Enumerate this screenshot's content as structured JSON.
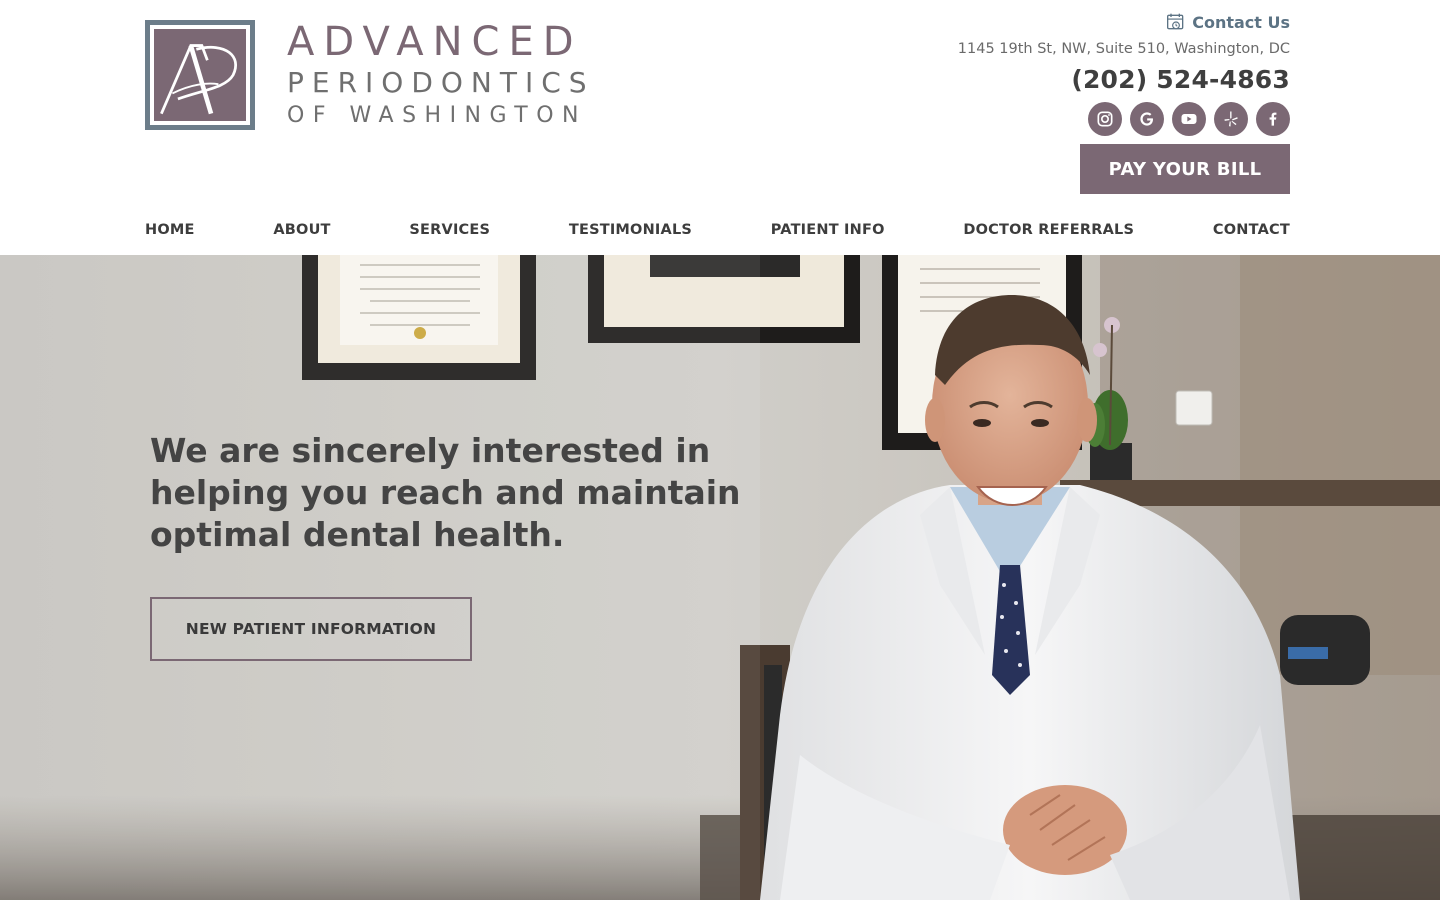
{
  "brand": {
    "line1": "ADVANCED",
    "line2": "PERIODONTICS",
    "line3": "OF WASHINGTON",
    "color_primary": "#7b6874",
    "color_frame": "#6c7d8a"
  },
  "contact": {
    "link_label": "Contact Us",
    "address": "1145 19th St, NW, Suite 510, Washington, DC",
    "phone": "(202) 524-4863"
  },
  "socials": [
    {
      "name": "instagram-icon"
    },
    {
      "name": "google-icon"
    },
    {
      "name": "youtube-icon"
    },
    {
      "name": "yelp-icon"
    },
    {
      "name": "facebook-icon"
    }
  ],
  "pay_bill_label": "PAY YOUR BILL",
  "nav": {
    "items": [
      "HOME",
      "ABOUT",
      "SERVICES",
      "TESTIMONIALS",
      "PATIENT INFO",
      "DOCTOR REFERRALS",
      "CONTACT"
    ]
  },
  "hero": {
    "heading": "We are sincerely interested in helping you reach and maintain optimal dental health.",
    "cta_label": "NEW PATIENT INFORMATION"
  }
}
